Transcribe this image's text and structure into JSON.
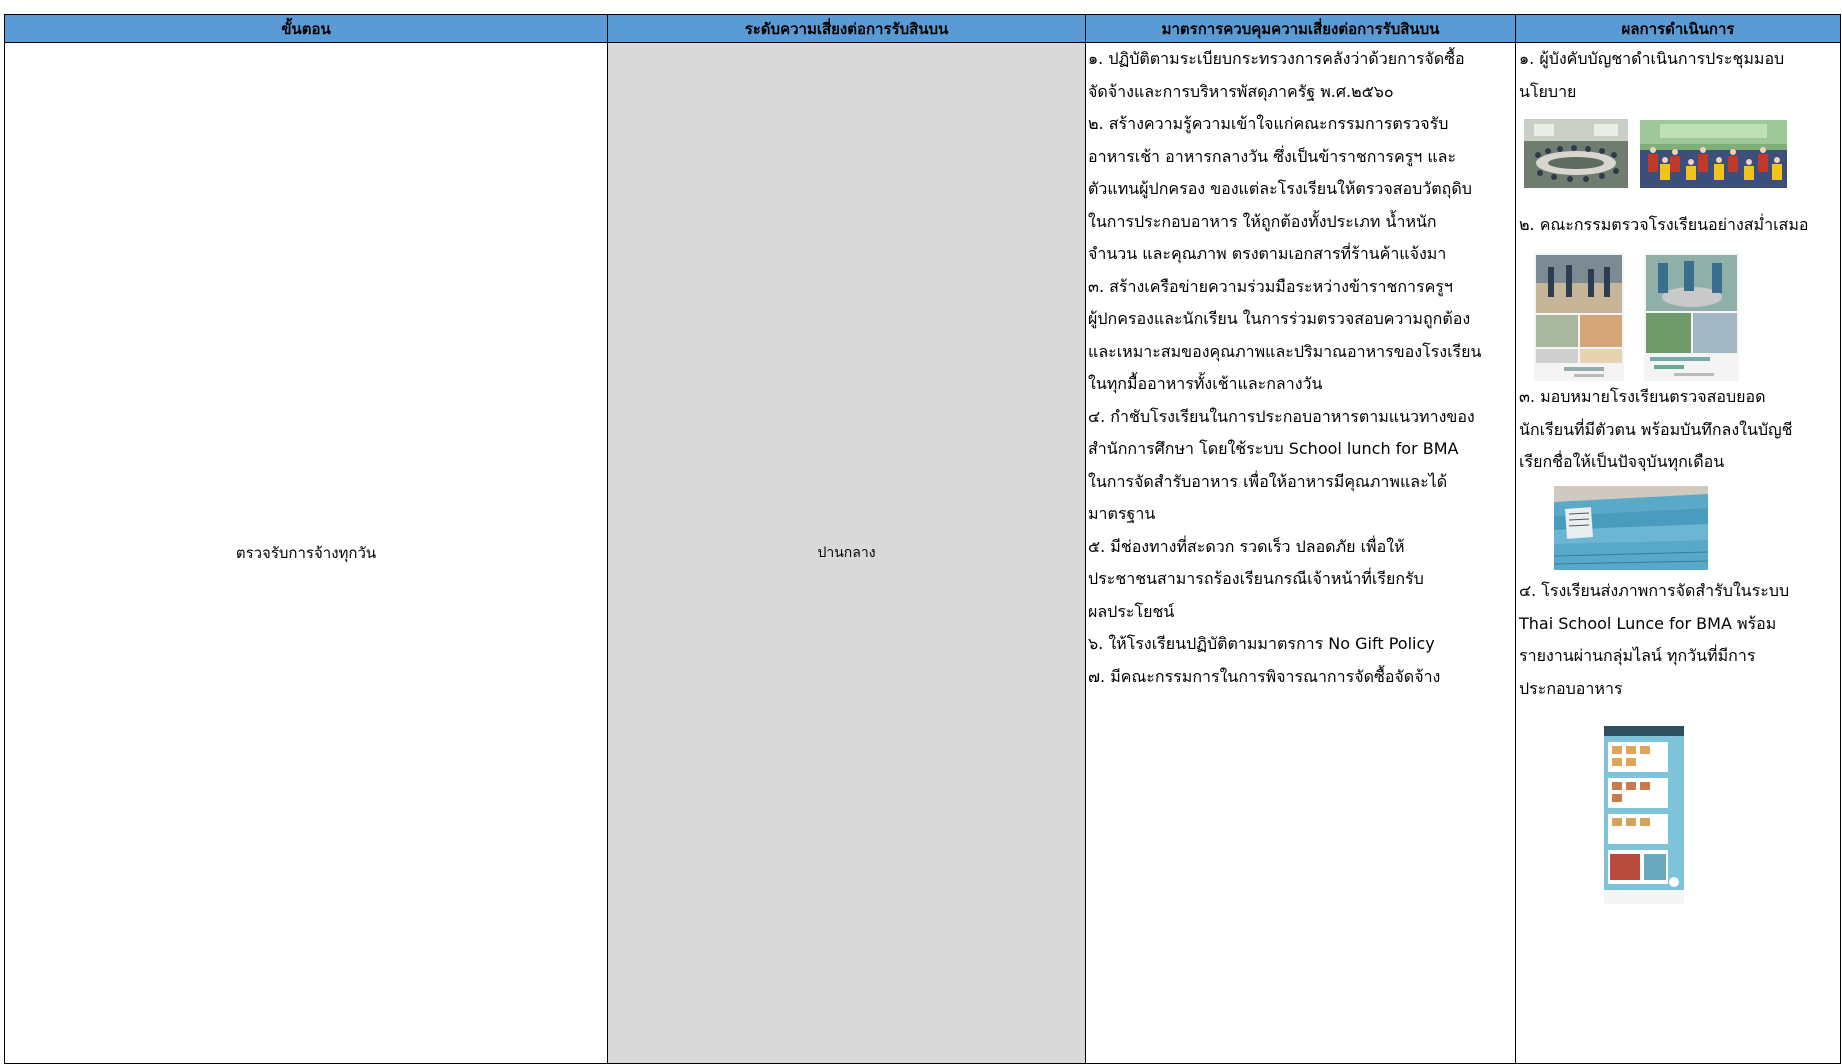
{
  "table": {
    "headers": {
      "step": "ขั้นตอน",
      "risk": "ระดับความเสี่ยงต่อการรับสินบน",
      "measures": "มาตรการควบคุมความเสี่ยงต่อการรับสินบน",
      "results": "ผลการดำเนินการ"
    },
    "row": {
      "step": "ตรวจรับการจ้างทุกวัน",
      "risk": "ปานกลาง",
      "measures_lines": [
        "๑. ปฏิบัติตามระเบียบกระทรวงการคลังว่าด้วยการจัดซื้อ",
        "จัดจ้างและการบริหารพัสดุภาครัฐ พ.ศ.๒๕๖๐",
        "๒. สร้างความรู้ความเข้าใจแก่คณะกรรมการตรวจรับ",
        "อาหารเช้า อาหารกลางวัน ซึ่งเป็นข้าราชการครูฯ และ",
        "ตัวแทนผู้ปกครอง ของแต่ละโรงเรียนให้ตรวจสอบวัตถุดิบ",
        "ในการประกอบอาหาร ให้ถูกต้องทั้งประเภท น้ำหนัก",
        "จำนวน และคุณภาพ ตรงตามเอกสารที่ร้านค้าแจ้งมา",
        "๓. สร้างเครือข่ายความร่วมมือระหว่างข้าราชการครูฯ",
        "ผู้ปกครองและนักเรียน ในการร่วมตรวจสอบความถูกต้อง",
        "และเหมาะสมของคุณภาพและปริมาณอาหารของโรงเรียน",
        "ในทุกมื้ออาหารทั้งเช้าและกลางวัน",
        "๔. กำชับโรงเรียนในการประกอบอาหารตามแนวทางของ",
        "สำนักการศึกษา โดยใช้ระบบ School lunch for BMA",
        "ในการจัดสำรับอาหาร เพื่อให้อาหารมีคุณภาพและได้",
        "มาตรฐาน",
        "๕. มีช่องทางที่สะดวก รวดเร็ว ปลอดภัย เพื่อให้",
        "ประชาชนสามารถร้องเรียนกรณีเจ้าหน้าที่เรียกรับ",
        "ผลประโยชน์",
        "๖. ให้โรงเรียนปฏิบัติตามมาตรการ No Gift Policy",
        "๗. มีคณะกรรมการในการพิจารณาการจัดซื้อจัดจ้าง"
      ],
      "results": {
        "item1_lines": [
          "๑. ผู้บังคับบัญชาดำเนินการประชุมมอบ",
          "นโยบาย"
        ],
        "item2_lines": [
          "๒. คณะกรรมตรวจโรงเรียนอย่างสม่ำเสมอ"
        ],
        "item3_lines": [
          "๓. มอบหมายโรงเรียนตรวจสอบยอด",
          "นักเรียนที่มีตัวตน พร้อมบันทึกลงในบัญชี",
          "เรียกชื่อให้เป็นปัจจุบันทุกเดือน"
        ],
        "item4_lines": [
          "๔. โรงเรียนส่งภาพการจัดสำรับในระบบ",
          "Thai School Lunce for BMA พร้อม",
          "รายงานผ่านกลุ่มไลน์ ทุกวันที่มีการ",
          "ประกอบอาหาร"
        ]
      }
    }
  },
  "colors": {
    "header_bg": "#5b9bd5",
    "risk_cell_bg": "#d9d9d9",
    "border": "#000000"
  }
}
